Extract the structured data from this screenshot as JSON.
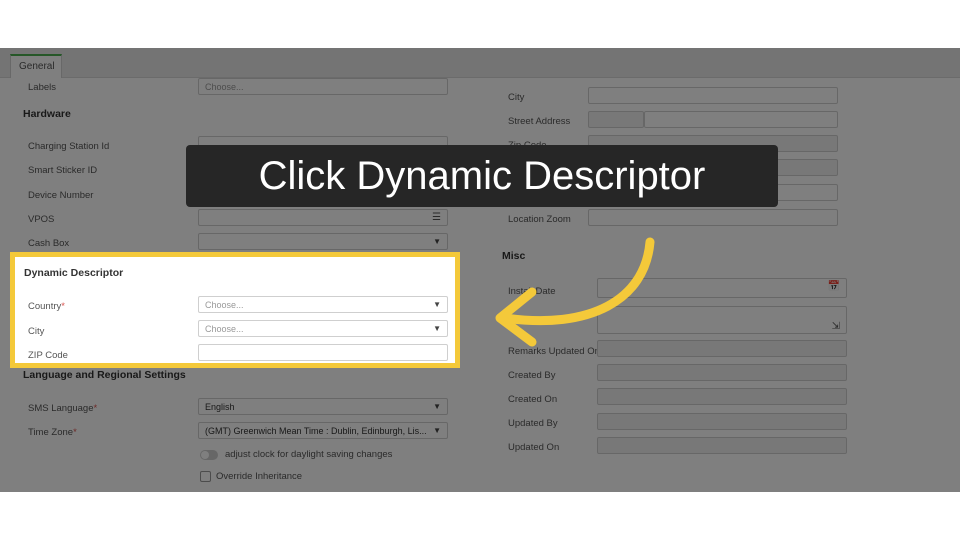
{
  "tab": {
    "general": "General"
  },
  "left": {
    "labels_label": "Labels",
    "labels_placeholder": "Choose...",
    "hardware_title": "Hardware",
    "charging_station_id": "Charging Station Id",
    "smart_sticker_id": "Smart Sticker ID",
    "device_number": "Device Number",
    "vpos": "VPOS",
    "cash_box": "Cash Box",
    "dynamic_descriptor_title": "Dynamic Descriptor",
    "country": "Country",
    "country_placeholder": "Choose...",
    "city": "City",
    "city_placeholder": "Choose...",
    "zip_code": "ZIP Code",
    "language_title": "Language and Regional Settings",
    "sms_language": "SMS Language",
    "sms_language_value": "English",
    "time_zone": "Time Zone",
    "time_zone_value": "(GMT) Greenwich Mean Time : Dublin, Edinburgh, Lis...",
    "daylight_saving": "adjust clock for daylight saving changes",
    "override_inheritance": "Override Inheritance"
  },
  "right": {
    "city": "City",
    "street_address": "Street Address",
    "zip_code": "Zip Code",
    "location_zoom": "Location Zoom",
    "misc_title": "Misc",
    "install_date": "Install Date",
    "remarks_updated_on": "Remarks Updated On",
    "created_by": "Created By",
    "created_on": "Created On",
    "updated_by": "Updated By",
    "updated_on": "Updated On"
  },
  "callout": {
    "text": "Click Dynamic Descriptor"
  },
  "colors": {
    "highlight": "#f4c93a",
    "callout_bg": "#262626",
    "tab_accent": "#4caf50",
    "required": "#d9534f"
  },
  "icons": [
    "calendar-icon",
    "list-icon",
    "caret-down-icon",
    "resize-icon",
    "arrow-icon"
  ]
}
